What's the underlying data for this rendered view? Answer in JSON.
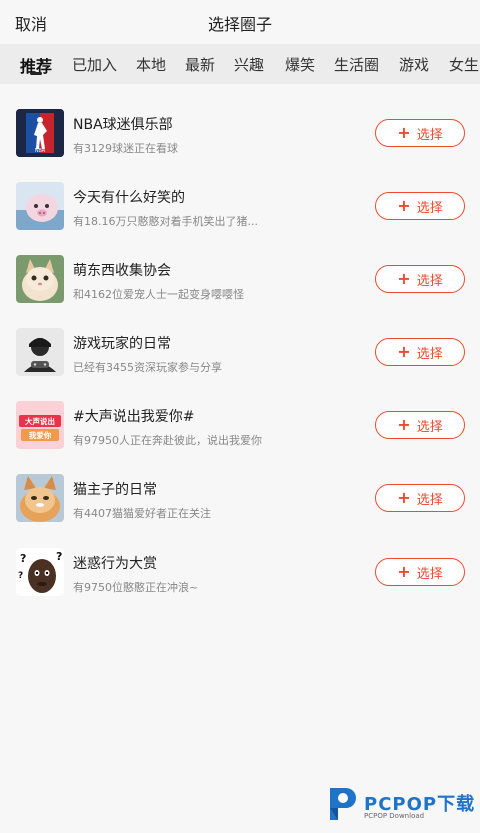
{
  "header": {
    "cancel_label": "取消",
    "title": "选择圈子"
  },
  "tabs": [
    {
      "label": "推荐"
    },
    {
      "label": "已加入"
    },
    {
      "label": "本地"
    },
    {
      "label": "最新"
    },
    {
      "label": "兴趣"
    },
    {
      "label": "爆笑"
    },
    {
      "label": "生活圈"
    },
    {
      "label": "游戏"
    },
    {
      "label": "女生"
    }
  ],
  "groups": [
    {
      "name": "NBA球迷俱乐部",
      "desc": "有3129球迷正在看球",
      "button": "选择",
      "icon": "nba-logo"
    },
    {
      "name": "今天有什么好笑的",
      "desc": "有18.16万只憨憨对着手机笑出了猪...",
      "button": "选择",
      "icon": "pig-photo"
    },
    {
      "name": "萌东西收集协会",
      "desc": "和4162位爱宠人士一起变身嘤嘤怪",
      "button": "选择",
      "icon": "cat-photo"
    },
    {
      "name": "游戏玩家的日常",
      "desc": "已经有3455资深玩家参与分享",
      "button": "选择",
      "icon": "gamer-avatar"
    },
    {
      "name": "#大声说出我爱你#",
      "desc": "有97950人正在奔赴彼此，说出我爱你",
      "button": "选择",
      "icon": "love-text-image"
    },
    {
      "name": "猫主子的日常",
      "desc": "有4407猫猫爱好者正在关注",
      "button": "选择",
      "icon": "cat-photo-2"
    },
    {
      "name": "迷惑行为大赏",
      "desc": "有9750位憨憨正在冲浪~",
      "button": "选择",
      "icon": "confused-meme"
    }
  ],
  "avatar_text": {
    "love": "大声说出我爱你"
  },
  "watermark": {
    "text": "PCPOP下载",
    "sub": "PCPOP Download"
  },
  "colors": {
    "accent": "#f04a2e",
    "watermark_blue": "#1f73c9"
  }
}
